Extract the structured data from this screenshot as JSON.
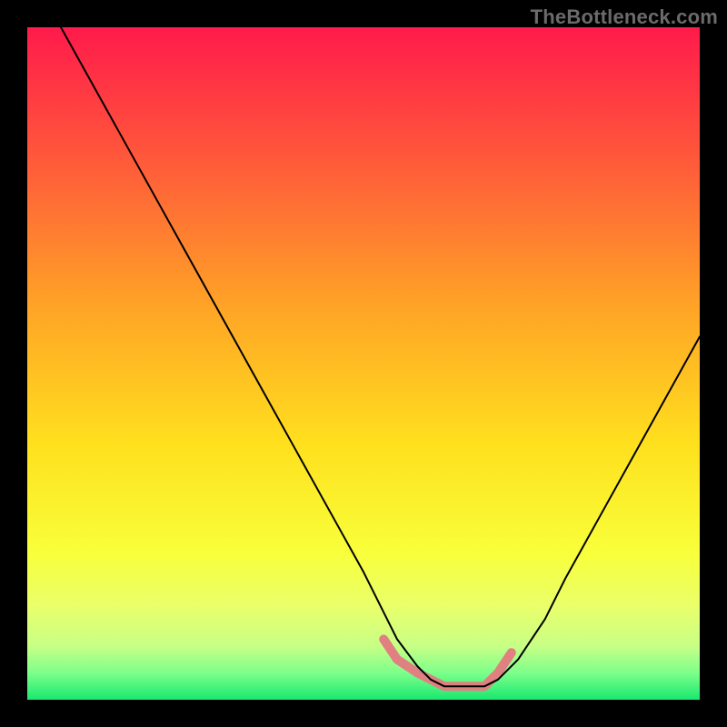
{
  "watermark": {
    "text": "TheBottleneck.com"
  },
  "chart_data": {
    "type": "line",
    "title": "",
    "xlabel": "",
    "ylabel": "",
    "xlim": [
      0,
      100
    ],
    "ylim": [
      0,
      100
    ],
    "grid": false,
    "legend": false,
    "background": {
      "type": "vertical-gradient",
      "stops": [
        {
          "pos": 0.0,
          "color": "#ff1a4b"
        },
        {
          "pos": 0.2,
          "color": "#ff5a3a"
        },
        {
          "pos": 0.42,
          "color": "#ffa526"
        },
        {
          "pos": 0.62,
          "color": "#ffe01e"
        },
        {
          "pos": 0.78,
          "color": "#f8ff3a"
        },
        {
          "pos": 0.86,
          "color": "#eaff6a"
        },
        {
          "pos": 0.92,
          "color": "#c8ff86"
        },
        {
          "pos": 0.96,
          "color": "#7dff8b"
        },
        {
          "pos": 1.0,
          "color": "#19e86f"
        }
      ]
    },
    "series": [
      {
        "name": "bottleneck-curve",
        "stroke": "#000000",
        "stroke_width": 2,
        "x": [
          5,
          10,
          15,
          20,
          25,
          30,
          35,
          40,
          45,
          50,
          53,
          55,
          58,
          60,
          62,
          65,
          68,
          70,
          73,
          77,
          80,
          85,
          90,
          95,
          100
        ],
        "y": [
          100,
          91,
          82,
          73,
          64,
          55,
          46,
          37,
          28,
          19,
          13,
          9,
          5,
          3,
          2,
          2,
          2,
          3,
          6,
          12,
          18,
          27,
          36,
          45,
          54
        ]
      },
      {
        "name": "highlight-band",
        "stroke": "#e08080",
        "stroke_width": 10,
        "x": [
          53,
          55,
          58,
          60,
          62,
          65,
          68,
          70,
          72
        ],
        "y": [
          9,
          6,
          4,
          3,
          2,
          2,
          2,
          4,
          7
        ]
      }
    ]
  }
}
